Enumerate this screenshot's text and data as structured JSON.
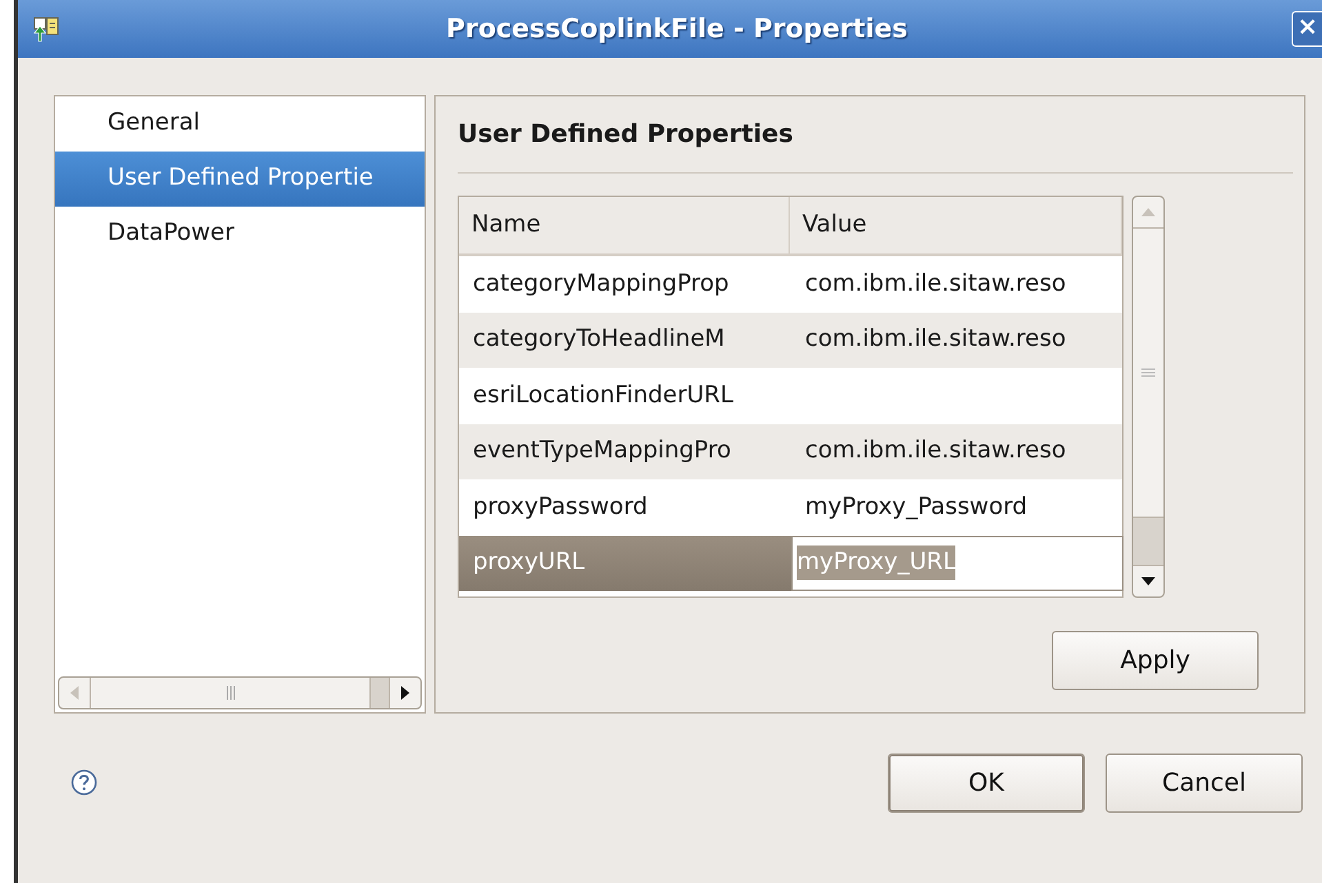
{
  "window": {
    "title": "ProcessCoplinkFile - Properties",
    "close_label": "×"
  },
  "sidebar": {
    "items": [
      {
        "label": "General",
        "selected": false
      },
      {
        "label": "User Defined Propertie",
        "selected": true
      },
      {
        "label": "DataPower",
        "selected": false
      }
    ]
  },
  "page": {
    "heading": "User Defined Properties",
    "table": {
      "columns": [
        "Name",
        "Value"
      ],
      "rows": [
        {
          "name": "categoryMappingProp",
          "value": "com.ibm.ile.sitaw.reso",
          "selected": false,
          "editing": false
        },
        {
          "name": "categoryToHeadlineM",
          "value": "com.ibm.ile.sitaw.reso",
          "selected": false,
          "editing": false
        },
        {
          "name": "esriLocationFinderURL",
          "value": "",
          "selected": false,
          "editing": false
        },
        {
          "name": "eventTypeMappingPro",
          "value": "com.ibm.ile.sitaw.reso",
          "selected": false,
          "editing": false
        },
        {
          "name": "proxyPassword",
          "value": "myProxy_Password",
          "selected": false,
          "editing": false
        },
        {
          "name": "proxyURL",
          "value": "myProxy_URL",
          "selected": true,
          "editing": true
        }
      ]
    },
    "apply_button": "Apply"
  },
  "buttons": [
    "OK",
    "Cancel"
  ]
}
